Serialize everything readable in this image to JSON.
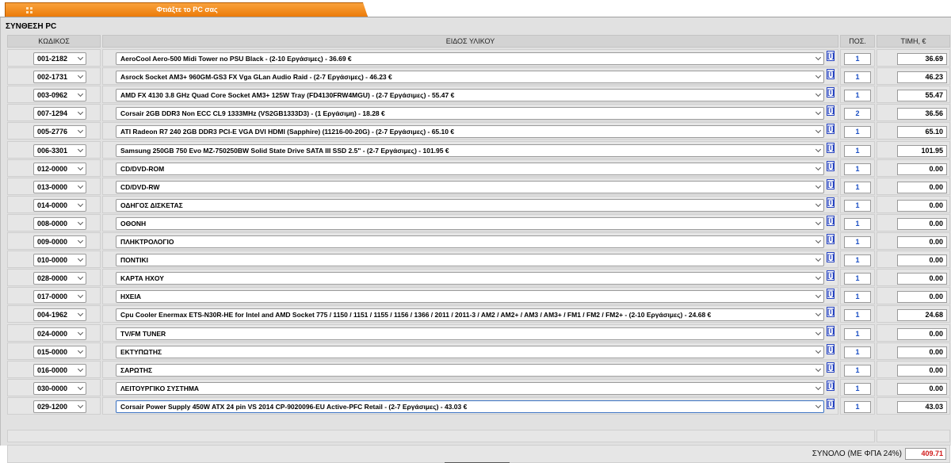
{
  "tab": {
    "label": "Φτιάξτε το PC σας"
  },
  "section_title": "ΣΥΝΘΕΣΗ PC",
  "headers": {
    "code": "ΚΩΔΙΚΟΣ",
    "item": "ΕΙΔΟΣ ΥΛΙΚΟΥ",
    "qty": "ΠΟΣ.",
    "price": "ΤΙΜΗ, €"
  },
  "info_label": "[i]",
  "rows": [
    {
      "code": "001-2182",
      "item": "AeroCool Aero-500 Midi Tower no PSU Black - (2-10 Εργάσιμες) - 36.69 €",
      "qty": "1",
      "price": "36.69"
    },
    {
      "code": "002-1731",
      "item": "Asrock Socket AM3+ 960GM-GS3 FX Vga GLan Audio Raid - (2-7 Εργάσιμες) - 46.23 €",
      "qty": "1",
      "price": "46.23"
    },
    {
      "code": "003-0962",
      "item": "AMD FX 4130 3.8 GHz Quad Core Socket AM3+ 125W Tray (FD4130FRW4MGU) - (2-7 Εργάσιμες) - 55.47 €",
      "qty": "1",
      "price": "55.47"
    },
    {
      "code": "007-1294",
      "item": "Corsair 2GB DDR3 Non ECC CL9 1333MHz (VS2GB1333D3) - (1 Εργάσιμη) - 18.28 €",
      "qty": "2",
      "price": "36.56"
    },
    {
      "code": "005-2776",
      "item": "ATI Radeon R7 240 2GB DDR3 PCI-E VGA DVI HDMI (Sapphire) (11216-00-20G) - (2-7 Εργάσιμες) - 65.10 €",
      "qty": "1",
      "price": "65.10"
    },
    {
      "code": "006-3301",
      "item": "Samsung 250GB 750 Evo MZ-750250BW Solid State Drive SATA III SSD 2.5\" - (2-7 Εργάσιμες) - 101.95 €",
      "qty": "1",
      "price": "101.95"
    },
    {
      "code": "012-0000",
      "item": "CD/DVD-ROM",
      "qty": "1",
      "price": "0.00"
    },
    {
      "code": "013-0000",
      "item": "CD/DVD-RW",
      "qty": "1",
      "price": "0.00"
    },
    {
      "code": "014-0000",
      "item": "ΟΔΗΓΟΣ ΔΙΣΚΕΤΑΣ",
      "qty": "1",
      "price": "0.00"
    },
    {
      "code": "008-0000",
      "item": "ΟΘΟΝΗ",
      "qty": "1",
      "price": "0.00"
    },
    {
      "code": "009-0000",
      "item": "ΠΛΗΚΤΡΟΛΟΓΙΟ",
      "qty": "1",
      "price": "0.00"
    },
    {
      "code": "010-0000",
      "item": "ΠΟΝΤΙΚΙ",
      "qty": "1",
      "price": "0.00"
    },
    {
      "code": "028-0000",
      "item": "ΚΑΡΤΑ ΗΧΟΥ",
      "qty": "1",
      "price": "0.00"
    },
    {
      "code": "017-0000",
      "item": "ΗΧΕΙΑ",
      "qty": "1",
      "price": "0.00"
    },
    {
      "code": "004-1962",
      "item": "Cpu Cooler Enermax ETS-N30R-HE for Intel and AMD Socket 775 / 1150 / 1151 / 1155 / 1156 / 1366 / 2011 / 2011-3 / AM2 / AM2+ / AM3 / AM3+ / FM1 / FM2 / FM2+ - (2-10 Εργάσιμες) - 24.68 €",
      "qty": "1",
      "price": "24.68"
    },
    {
      "code": "024-0000",
      "item": "TV/FM TUNER",
      "qty": "1",
      "price": "0.00"
    },
    {
      "code": "015-0000",
      "item": "ΕΚΤΥΠΩΤΗΣ",
      "qty": "1",
      "price": "0.00"
    },
    {
      "code": "016-0000",
      "item": "ΣΑΡΩΤΗΣ",
      "qty": "1",
      "price": "0.00"
    },
    {
      "code": "030-0000",
      "item": "ΛΕΙΤΟΥΡΓΙΚΟ ΣΥΣΤΗΜΑ",
      "qty": "1",
      "price": "0.00"
    },
    {
      "code": "029-1200",
      "item": "Corsair Power Supply 450W ATX 24 pin VS 2014 CP-9020096-EU Active-PFC Retail - (2-7 Εργάσιμες) - 43.03 €",
      "qty": "1",
      "price": "43.03"
    }
  ],
  "total": {
    "label": "ΣΥΝΟΛΟ (ΜΕ ΦΠΑ 24%)",
    "value": "409.71"
  },
  "colors": {
    "tab_orange": "#ec7b0a",
    "qty_blue": "#1b4fc4",
    "total_red": "#d11a1a",
    "info_blue": "#2441c0"
  }
}
